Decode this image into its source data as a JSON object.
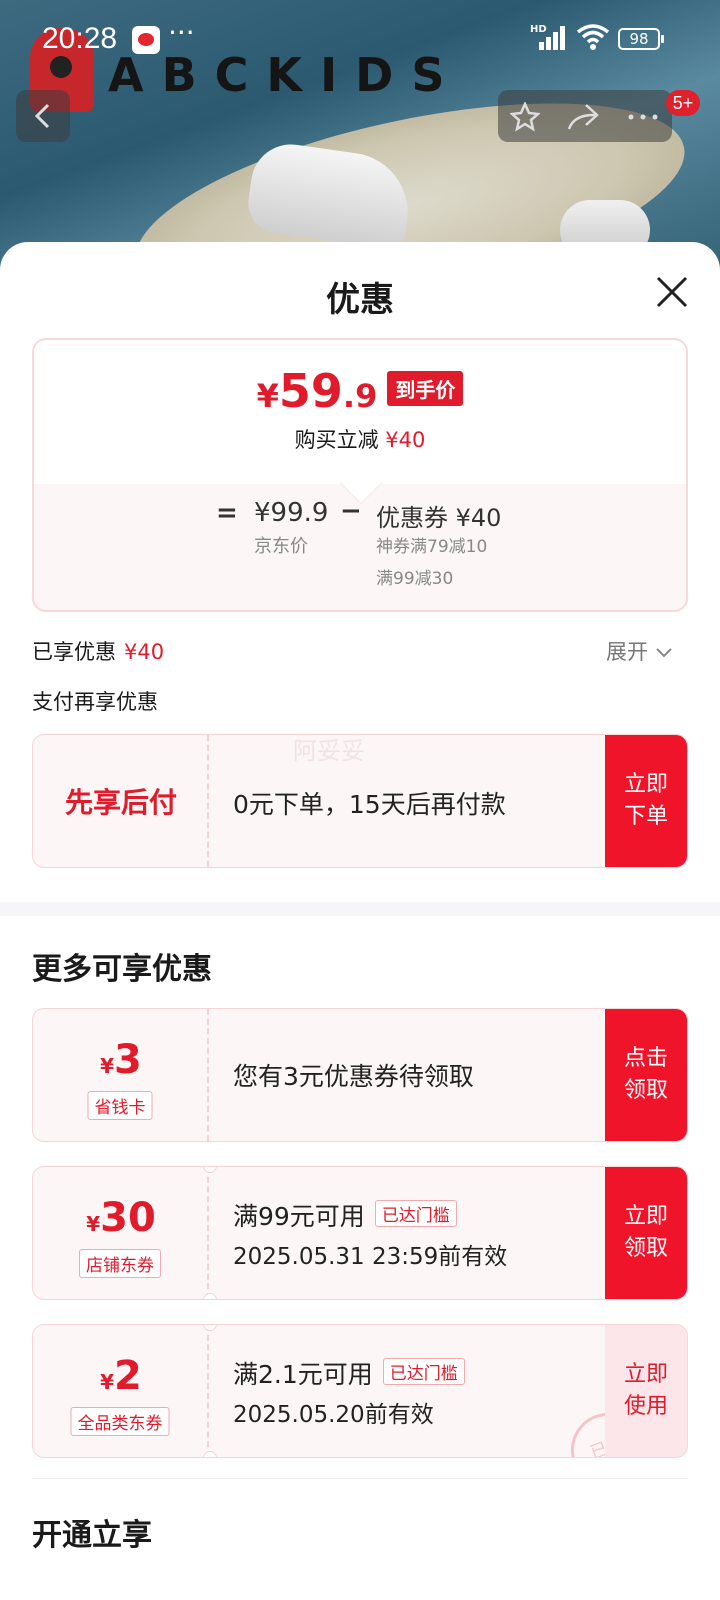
{
  "status_bar": {
    "time": "20:28",
    "dots": "···",
    "network": "HD",
    "wifi_sub": "7",
    "battery": "98"
  },
  "header": {
    "brand": "ABCKIDS",
    "badge": "5+",
    "icons": [
      "back-icon",
      "star-icon",
      "share-icon",
      "more-icon"
    ]
  },
  "sheet": {
    "title": "优惠",
    "price": {
      "yen": "¥",
      "int": "59",
      "dec": ".9",
      "tag": "到手价",
      "instant_label": "购买立减",
      "instant_value": "¥40",
      "eq": "=",
      "base": "¥99.9",
      "base_label": "京东价",
      "minus": "−",
      "coupon_line": "优惠券 ¥40",
      "coupon_rule1": "神券满79减10",
      "coupon_rule2": "满99减30"
    },
    "enjoyed_label": "已享优惠",
    "enjoyed_value": "¥40",
    "expand": "展开",
    "pay_more": "支付再享优惠",
    "bnpl": {
      "title": "先享后付",
      "watermark": "阿妥妥",
      "text": "0元下单，15天后再付款",
      "btn1": "立即",
      "btn2": "下单"
    },
    "more_title": "更多可享优惠",
    "coupons": [
      {
        "yen": "¥",
        "amount": "3",
        "tag": "省钱卡",
        "line1": "您有3元优惠券待领取",
        "reached": "",
        "line2": "",
        "btn1": "点击",
        "btn2": "领取"
      },
      {
        "yen": "¥",
        "amount": "30",
        "tag": "店铺东券",
        "line1": "满99元可用",
        "reached": "已达门槛",
        "line2": "2025.05.31  23:59前有效",
        "btn1": "立即",
        "btn2": "领取"
      },
      {
        "yen": "¥",
        "amount": "2",
        "tag": "全品类东券",
        "line1": "满2.1元可用",
        "reached": "已达门槛",
        "line2": "2025.05.20前有效",
        "btn1": "立即",
        "btn2": "使用",
        "stamp": "已领"
      }
    ],
    "open_title": "开通立享"
  },
  "colors": {
    "accent": "#e01b2b",
    "button": "#f0142b",
    "card_bg": "#fcf6f6"
  }
}
